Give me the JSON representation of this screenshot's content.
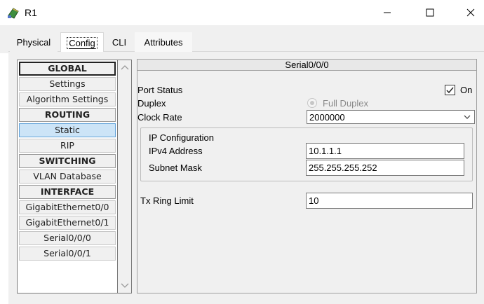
{
  "window": {
    "title": "R1",
    "app_icon": "router-app-icon"
  },
  "tabs": [
    {
      "label": "Physical"
    },
    {
      "label": "Config"
    },
    {
      "label": "CLI"
    },
    {
      "label": "Attributes"
    }
  ],
  "active_tab": "Config",
  "nav": {
    "items": [
      {
        "label": "GLOBAL",
        "kind": "header"
      },
      {
        "label": "Settings",
        "kind": "item"
      },
      {
        "label": "Algorithm Settings",
        "kind": "item"
      },
      {
        "label": "ROUTING",
        "kind": "header"
      },
      {
        "label": "Static",
        "kind": "item",
        "selected": true
      },
      {
        "label": "RIP",
        "kind": "item"
      },
      {
        "label": "SWITCHING",
        "kind": "header"
      },
      {
        "label": "VLAN Database",
        "kind": "item"
      },
      {
        "label": "INTERFACE",
        "kind": "header"
      },
      {
        "label": "GigabitEthernet0/0",
        "kind": "item"
      },
      {
        "label": "GigabitEthernet0/1",
        "kind": "item"
      },
      {
        "label": "Serial0/0/0",
        "kind": "item"
      },
      {
        "label": "Serial0/0/1",
        "kind": "item"
      }
    ]
  },
  "panel": {
    "title": "Serial0/0/0",
    "port_status": {
      "label": "Port Status",
      "checkbox_label": "On",
      "checked": true
    },
    "duplex": {
      "label": "Duplex",
      "option_label": "Full Duplex",
      "enabled": false
    },
    "clock_rate": {
      "label": "Clock Rate",
      "value": "2000000"
    },
    "ip_config": {
      "title": "IP Configuration",
      "ipv4_label": "IPv4 Address",
      "ipv4_value": "10.1.1.1",
      "mask_label": "Subnet Mask",
      "mask_value": "255.255.255.252"
    },
    "tx_ring": {
      "label": "Tx Ring Limit",
      "value": "10"
    }
  },
  "colors": {
    "selected_item_bg": "#cce4f7",
    "selected_item_border": "#5ea0d8",
    "panel_bg": "#f0f0f0"
  }
}
